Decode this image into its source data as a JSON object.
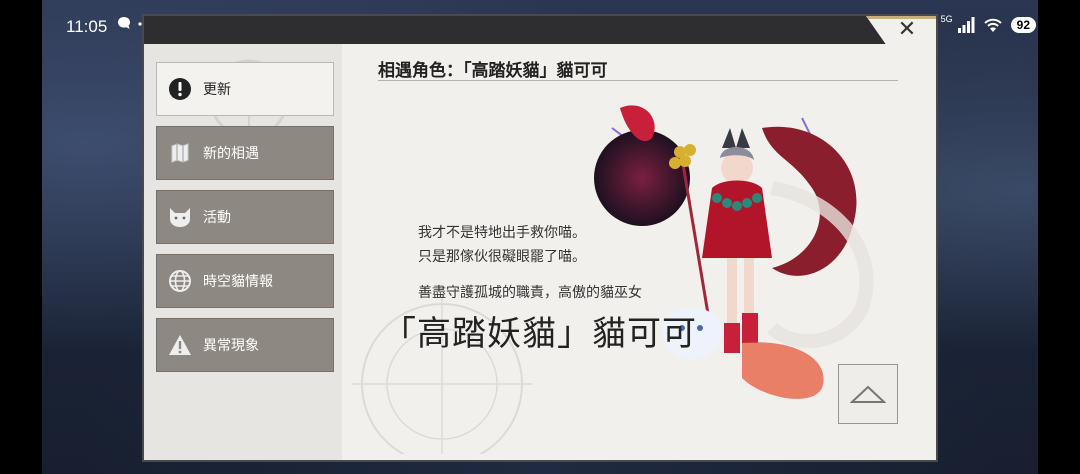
{
  "status_bar": {
    "time": "11:05",
    "network": "5G",
    "battery": "92"
  },
  "dialog": {
    "close_label": "✕"
  },
  "sidebar": {
    "items": [
      {
        "label": "更新",
        "icon": "alert-circle-icon"
      },
      {
        "label": "新的相遇",
        "icon": "scroll-icon"
      },
      {
        "label": "活動",
        "icon": "cat-face-icon"
      },
      {
        "label": "時空貓情報",
        "icon": "globe-icon"
      },
      {
        "label": "異常現象",
        "icon": "warning-icon"
      }
    ]
  },
  "main": {
    "title": "相遇角色：「高踏妖貓」貓可可",
    "quote_lines": [
      "我才不是特地出手救你喵。",
      "只是那傢伙很礙眼罷了喵。"
    ],
    "subtitle": "善盡守護孤城的職責，高傲的貓巫女",
    "character_name": "「高踏妖貓」貓可可"
  },
  "colors": {
    "accent": "#c9b074",
    "menu_inactive": "#8e8882",
    "menu_active": "#f3f2ef"
  }
}
